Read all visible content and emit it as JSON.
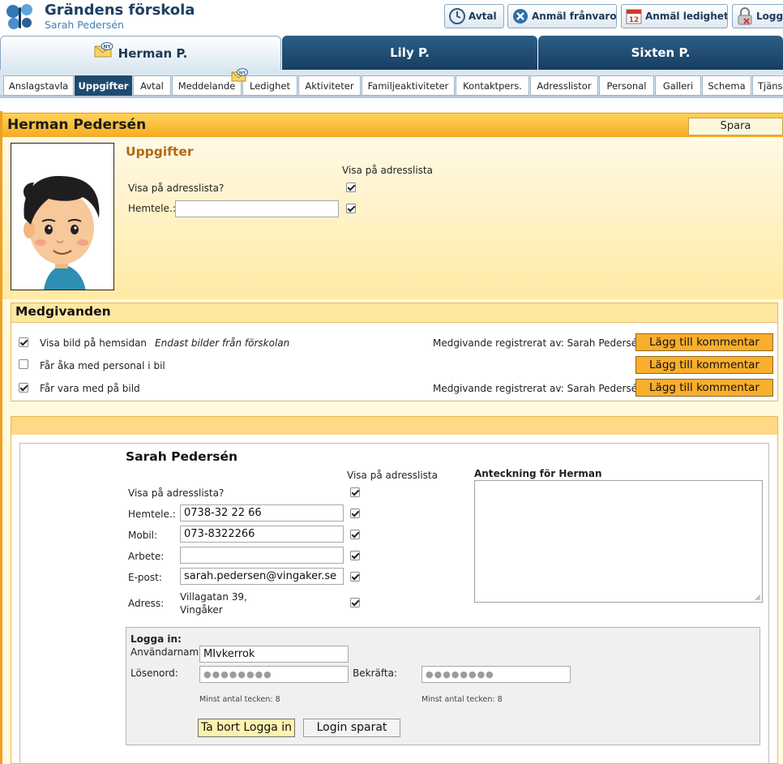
{
  "header": {
    "school_name": "Grändens förskola",
    "user_name": "Sarah Pedersén",
    "buttons": {
      "avtal": "Avtal",
      "anmal_franvaro": "Anmäl frånvaro",
      "anmal_ledighet": "Anmäl ledighet",
      "logga": "Logga",
      "calendar_day": "12"
    }
  },
  "child_tabs": [
    {
      "label": "Herman P.",
      "active": true
    },
    {
      "label": "Lily P.",
      "active": false
    },
    {
      "label": "Sixten P.",
      "active": false
    }
  ],
  "badge_text": "NY",
  "sub_tabs": [
    {
      "label": "Anslagstavla"
    },
    {
      "label": "Uppgifter",
      "active": true
    },
    {
      "label": "Avtal"
    },
    {
      "label": "Meddelande"
    },
    {
      "label": "Ledighet"
    },
    {
      "label": "Aktiviteter"
    },
    {
      "label": "Familjeaktiviteter"
    },
    {
      "label": "Kontaktpers."
    },
    {
      "label": "Adresslistor"
    },
    {
      "label": "Personal"
    },
    {
      "label": "Galleri"
    },
    {
      "label": "Schema"
    },
    {
      "label": "Tjäns"
    }
  ],
  "child": {
    "name": "Herman Pedersén",
    "save_label": "Spara",
    "section_heading": "Uppgifter",
    "visa_col_header": "Visa på adresslista",
    "visa_label": "Visa på adresslista?",
    "visa_checked": true,
    "hemtele_label": "Hemtele.:",
    "hemtele_value": "",
    "hemtele_checked": true
  },
  "medgivanden": {
    "title": "Medgivanden",
    "comment_button": "Lägg till kommentar",
    "rows": [
      {
        "label": "Visa bild på hemsidan",
        "checked": true,
        "note": "Endast bilder från förskolan",
        "registered": "Medgivande registrerat av: Sarah Pedersén"
      },
      {
        "label": "Får åka med personal i bil",
        "checked": false,
        "note": "",
        "registered": ""
      },
      {
        "label": "Får vara med på bild",
        "checked": true,
        "note": "",
        "registered": "Medgivande registrerat av: Sarah Pedersén"
      }
    ]
  },
  "guardian": {
    "name": "Sarah Pedersén",
    "visa_col_header": "Visa på adresslista",
    "visa_label": "Visa på adresslista?",
    "fields": [
      {
        "label": "Hemtele.:",
        "value": "0738-32 22 66",
        "checked": true
      },
      {
        "label": "Mobil:",
        "value": "073-8322266",
        "checked": true
      },
      {
        "label": "Arbete:",
        "value": "",
        "checked": true
      },
      {
        "label": "E-post:",
        "value": "sarah.pedersen@vingaker.se",
        "checked": true
      }
    ],
    "address_label": "Adress:",
    "address_line1": "Villagatan 39,",
    "address_line2": "Vingåker",
    "address_checked": true,
    "visa_checked": true,
    "note_label": "Anteckning för Herman"
  },
  "login": {
    "title": "Logga in:",
    "username_label": "Användarnamn:",
    "username_value": "MIvkerrok",
    "password_label": "Lösenord:",
    "password_value": "●●●●●●●●",
    "confirm_label": "Bekräfta:",
    "confirm_value": "●●●●●●●●",
    "min_chars": "Minst antal tecken: 8",
    "remove_button": "Ta bort Logga in",
    "saved_button": "Login sparat"
  }
}
